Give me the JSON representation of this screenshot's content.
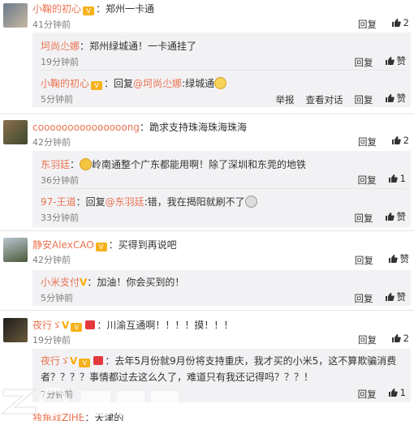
{
  "comments": [
    {
      "user": "小鞠的初心",
      "text": "：郑州一卡通",
      "time": "41分钟前",
      "reply_label": "回复",
      "likes": "2",
      "replies": [
        {
          "user": "坷尚尐娜",
          "text": "：郑州绿城通！一卡通挂了",
          "time": "19分钟前",
          "reply_label": "回复",
          "like_label": "赞"
        },
        {
          "user": "小鞠的初心",
          "text": "：回复",
          "mention": "@坷尚尐娜",
          "text2": ":绿城通",
          "time": "5分钟前",
          "report_label": "举报",
          "view_label": "查看对话",
          "reply_label": "回复",
          "like_label": "赞"
        }
      ]
    },
    {
      "user": "cooooooooooooooong",
      "text": "：跪求支持珠海珠海珠海",
      "time": "42分钟前",
      "reply_label": "回复",
      "likes": "2",
      "replies": [
        {
          "user": "东羽廷",
          "text": "：",
          "text2": "岭南通整个广东都能用啊！除了深圳和东莞的地铁",
          "time": "36分钟前",
          "reply_label": "回复",
          "likes": "1"
        },
        {
          "user": "97-王道",
          "text": "：回复",
          "mention": "@东羽廷",
          "text2": ":错，我在揭阳就刷不了",
          "time": "33分钟前",
          "reply_label": "回复",
          "like_label": "赞"
        }
      ]
    },
    {
      "user": "静安AlexCAO",
      "text": "：买得到再说吧",
      "time": "42分钟前",
      "reply_label": "回复",
      "like_label": "赞",
      "replies": [
        {
          "user": "小米支付",
          "text": "：加油！你会买到的！",
          "time": "5分钟前",
          "reply_label": "回复",
          "like_label": "赞"
        }
      ]
    },
    {
      "user": "夜行ゞ",
      "text": "：川渝互通啊！！！！摸！！！",
      "time": "19分钟前",
      "reply_label": "回复",
      "likes": "2",
      "replies": [
        {
          "user": "夜行ゞ",
          "text": "：去年5月份就9月份将支持重庆，我才买的小米5，这不算欺骗消费",
          "text_line2": "者？？？？事情都过去这么久了，难道只有我还记得吗？？？！",
          "time": "7分钟前",
          "reply_label": "回复",
          "likes": "1"
        }
      ]
    },
    {
      "user": "独角戏ZJHE",
      "text": "：天津的",
      "time": "",
      "reply_label": ""
    }
  ],
  "watermark": "ZOL中关村在线",
  "colors": {
    "username": "#eb7350",
    "subBg": "#f2f2f5",
    "meta": "#808080"
  }
}
